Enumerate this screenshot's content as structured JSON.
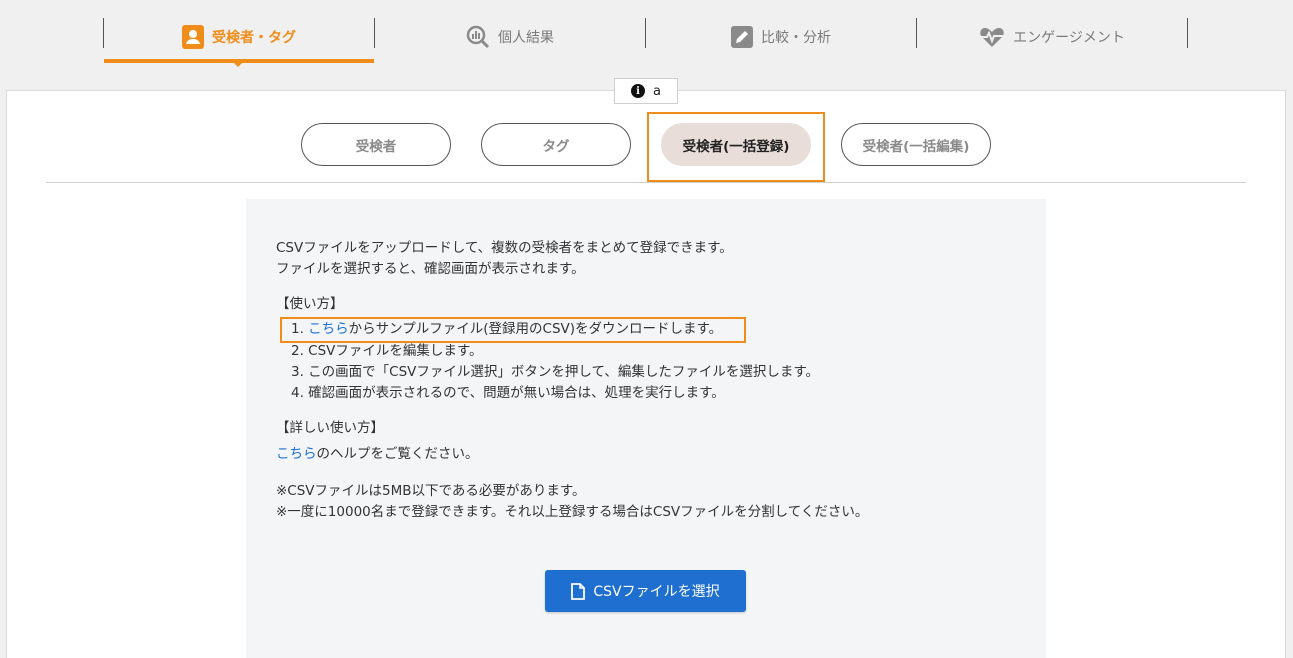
{
  "nav": {
    "tabs": [
      {
        "label": "受検者・タグ",
        "icon": "contacts-icon",
        "active": true
      },
      {
        "label": "個人結果",
        "icon": "analytics-search-icon",
        "active": false
      },
      {
        "label": "比較・分析",
        "icon": "edit-square-icon",
        "active": false
      },
      {
        "label": "エンゲージメント",
        "icon": "heartbeat-icon",
        "active": false
      }
    ],
    "accent_color": "#f08c1a"
  },
  "info_tag": {
    "icon": "info-icon",
    "label": "a"
  },
  "subtabs": [
    {
      "label": "受検者",
      "active": false
    },
    {
      "label": "タグ",
      "active": false
    },
    {
      "label": "受検者(一括登録)",
      "active": true
    },
    {
      "label": "受検者(一括編集)",
      "active": false
    }
  ],
  "content": {
    "intro_line1": "CSVファイルをアップロードして、複数の受検者をまとめて登録できます。",
    "intro_line2": "ファイルを選択すると、確認画面が表示されます。",
    "howto_heading": "【使い方】",
    "step1_prefix": "1. ",
    "step1_link": "こちら",
    "step1_suffix": "からサンプルファイル(登録用のCSV)をダウンロードします。",
    "step2": "2. CSVファイルを編集します。",
    "step3": "3. この画面で「CSVファイル選択」ボタンを押して、編集したファイルを選択します。",
    "step4": "4. 確認画面が表示されるので、問題が無い場合は、処理を実行します。",
    "detail_heading": "【詳しい使い方】",
    "help_link": "こちら",
    "help_suffix": "のヘルプをご覧ください。",
    "note1": "※CSVファイルは5MB以下である必要があります。",
    "note2": "※一度に10000名まで登録できます。それ以上登録する場合はCSVファイルを分割してください。"
  },
  "csv_button": {
    "label": "CSVファイルを選択",
    "icon": "file-icon",
    "color": "#1e6fd0"
  }
}
